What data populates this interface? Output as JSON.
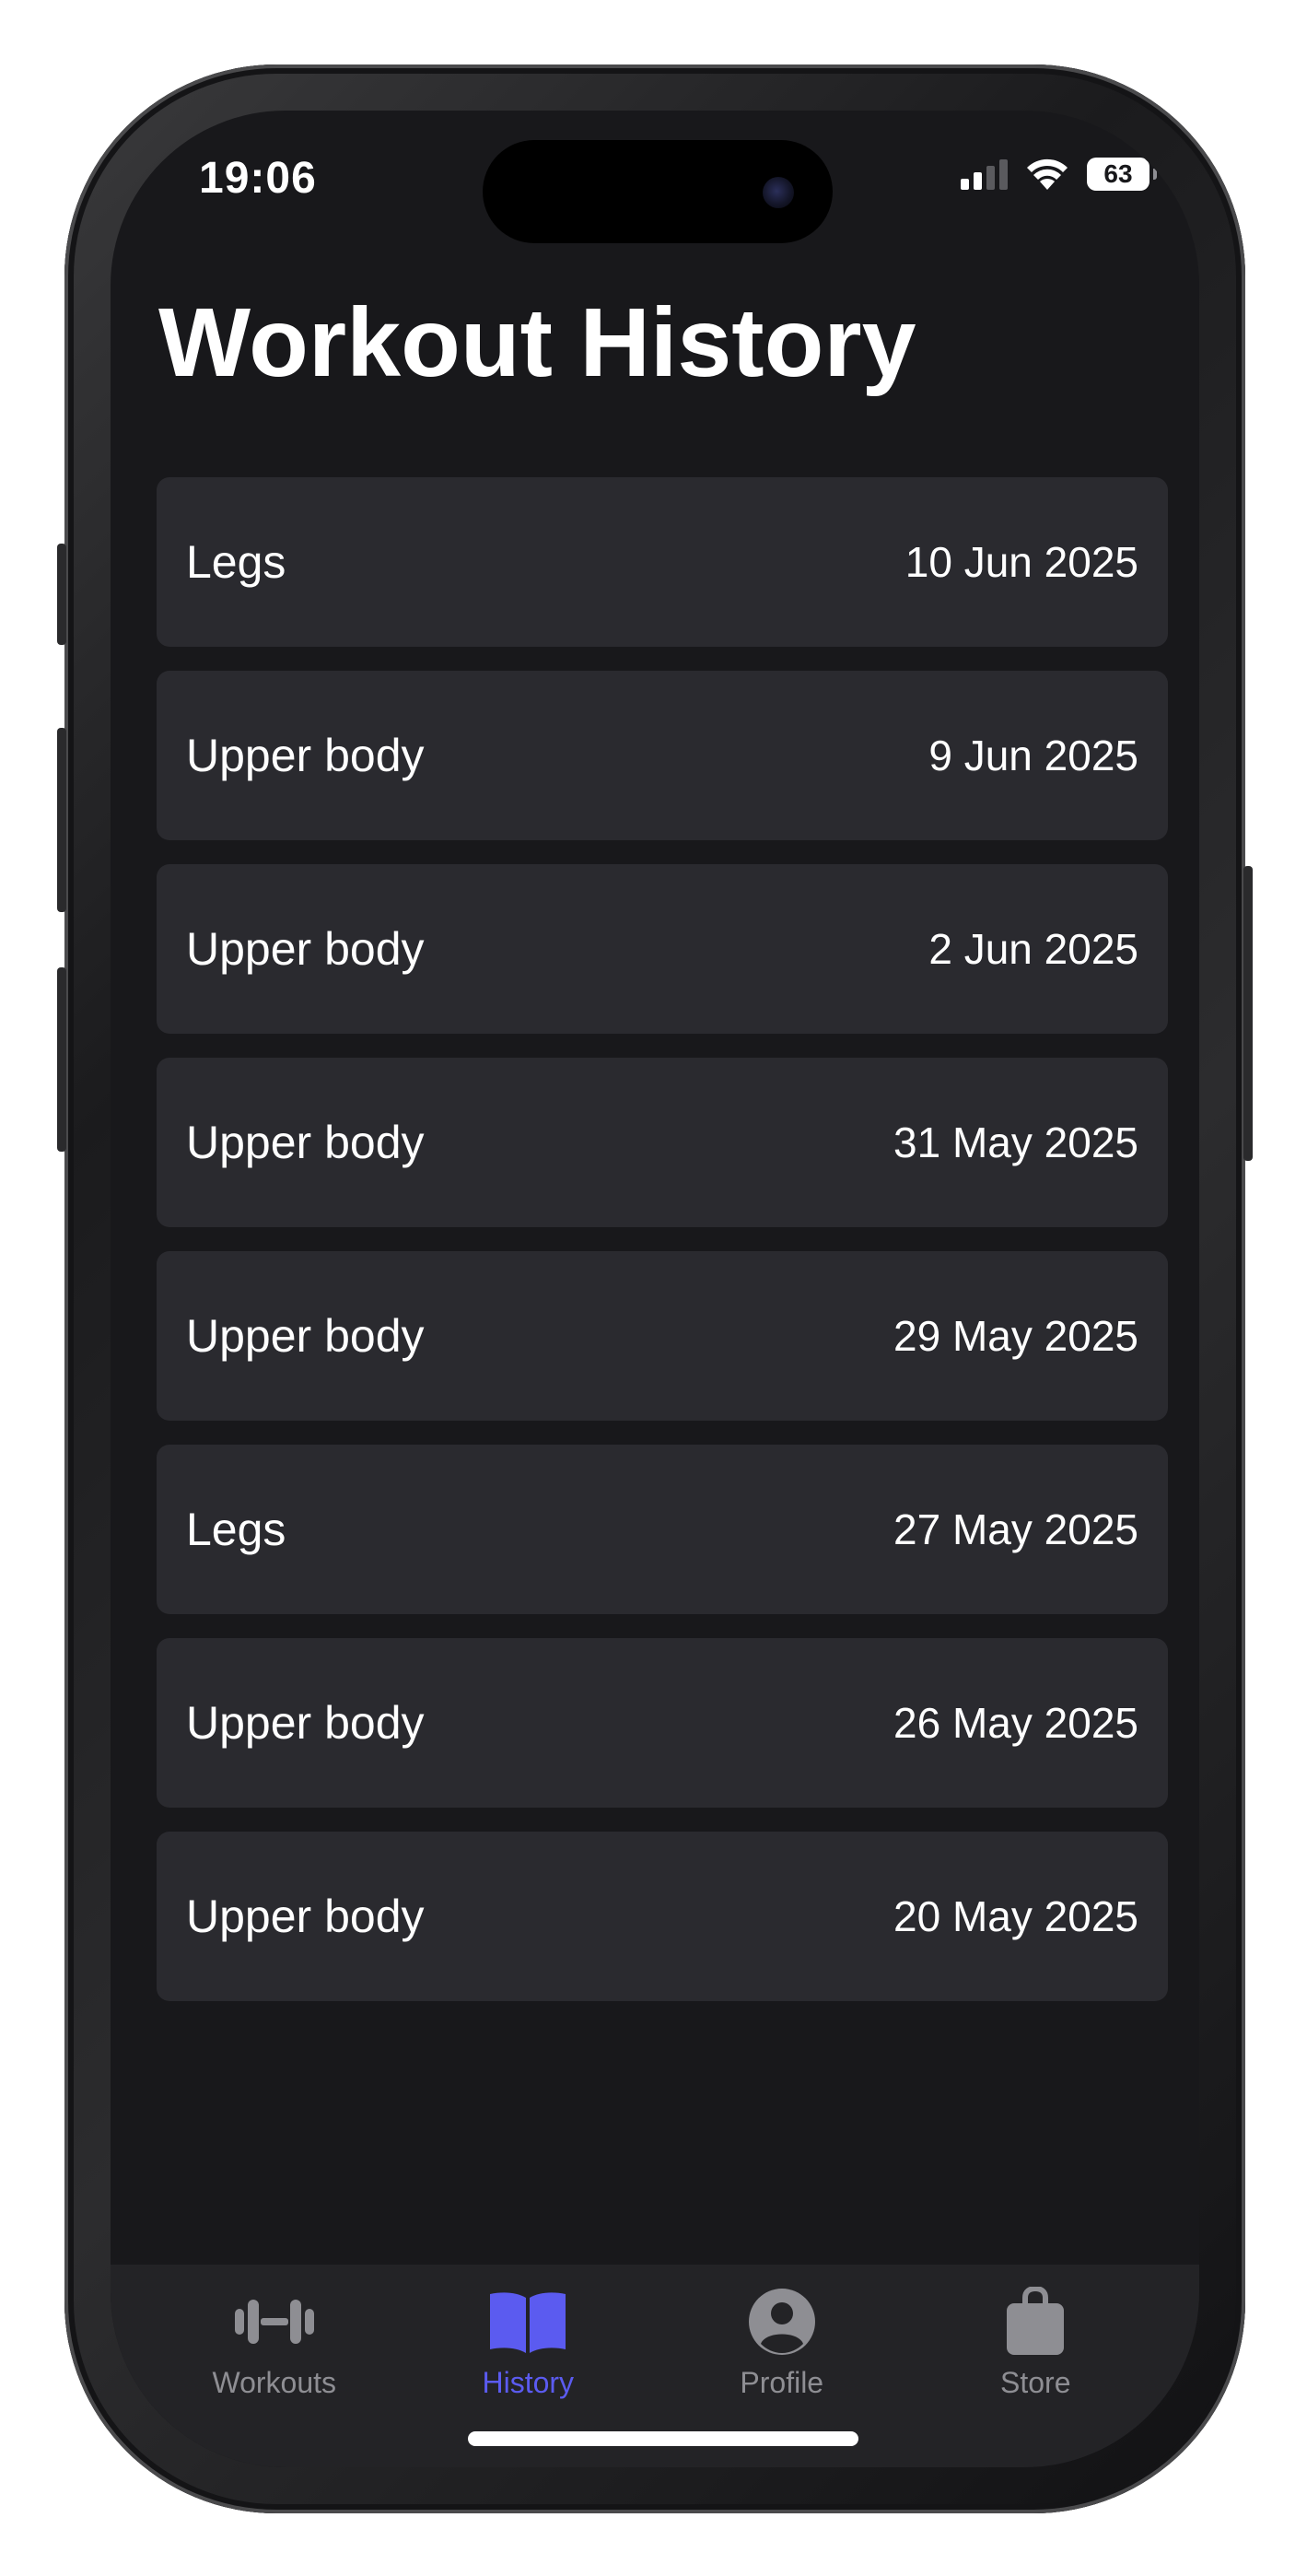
{
  "status_bar": {
    "time": "19:06",
    "battery": "63",
    "icons": [
      "cellular-signal-icon",
      "wifi-icon",
      "battery-icon"
    ]
  },
  "header": {
    "title": "Workout History"
  },
  "history": {
    "items": [
      {
        "name": "Legs",
        "date": "10 Jun 2025"
      },
      {
        "name": "Upper body",
        "date": "9 Jun 2025"
      },
      {
        "name": "Upper body",
        "date": "2 Jun 2025"
      },
      {
        "name": "Upper body",
        "date": "31 May 2025"
      },
      {
        "name": "Upper body",
        "date": "29 May 2025"
      },
      {
        "name": "Legs",
        "date": "27 May 2025"
      },
      {
        "name": "Upper body",
        "date": "26 May 2025"
      },
      {
        "name": "Upper body",
        "date": "20 May 2025"
      }
    ]
  },
  "tab_bar": {
    "tabs": [
      {
        "label": "Workouts",
        "icon": "dumbbell-icon",
        "active": false
      },
      {
        "label": "History",
        "icon": "book-icon",
        "active": true
      },
      {
        "label": "Profile",
        "icon": "person-circle-icon",
        "active": false
      },
      {
        "label": "Store",
        "icon": "shopping-bag-icon",
        "active": false
      }
    ]
  },
  "colors": {
    "background": "#18181b",
    "row_background": "#2a2a2f",
    "tab_bar_background": "#232326",
    "accent": "#5b5bf0",
    "inactive": "#8e8e93",
    "text": "#ffffff"
  }
}
